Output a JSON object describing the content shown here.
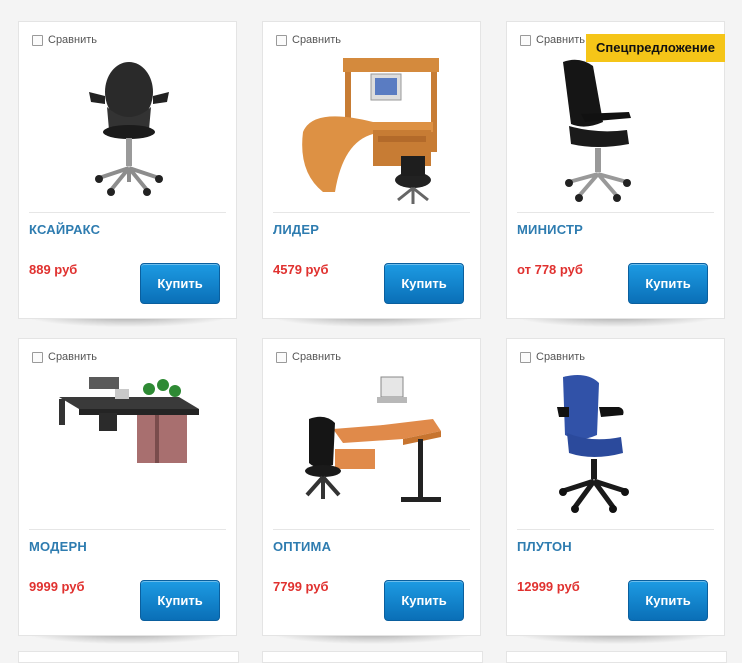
{
  "compare_label": "Сравнить",
  "buy_label": "Купить",
  "badge_label": "Спецпредложение",
  "accent_colors": {
    "title": "#2e7cb0",
    "price": "#e0312f",
    "button": "#1d9be3",
    "badge": "#f5c518"
  },
  "products": [
    {
      "name": "КСАЙРАКС",
      "price": "889 руб",
      "image": "office-chair-black-mesh",
      "badge": false
    },
    {
      "name": "ЛИДЕР",
      "price": "4579 руб",
      "image": "computer-desk-set",
      "badge": false
    },
    {
      "name": "МИНИСТР",
      "price": "от  778 руб",
      "image": "executive-chair-black",
      "badge": true
    },
    {
      "name": "МОДЕРН",
      "price": "9999 руб",
      "image": "office-workstation-set",
      "badge": false
    },
    {
      "name": "ОПТИМА",
      "price": "7799 руб",
      "image": "desk-with-chair",
      "badge": false
    },
    {
      "name": "ПЛУТОН",
      "price": "12999 руб",
      "image": "office-chair-blue",
      "badge": false
    }
  ]
}
